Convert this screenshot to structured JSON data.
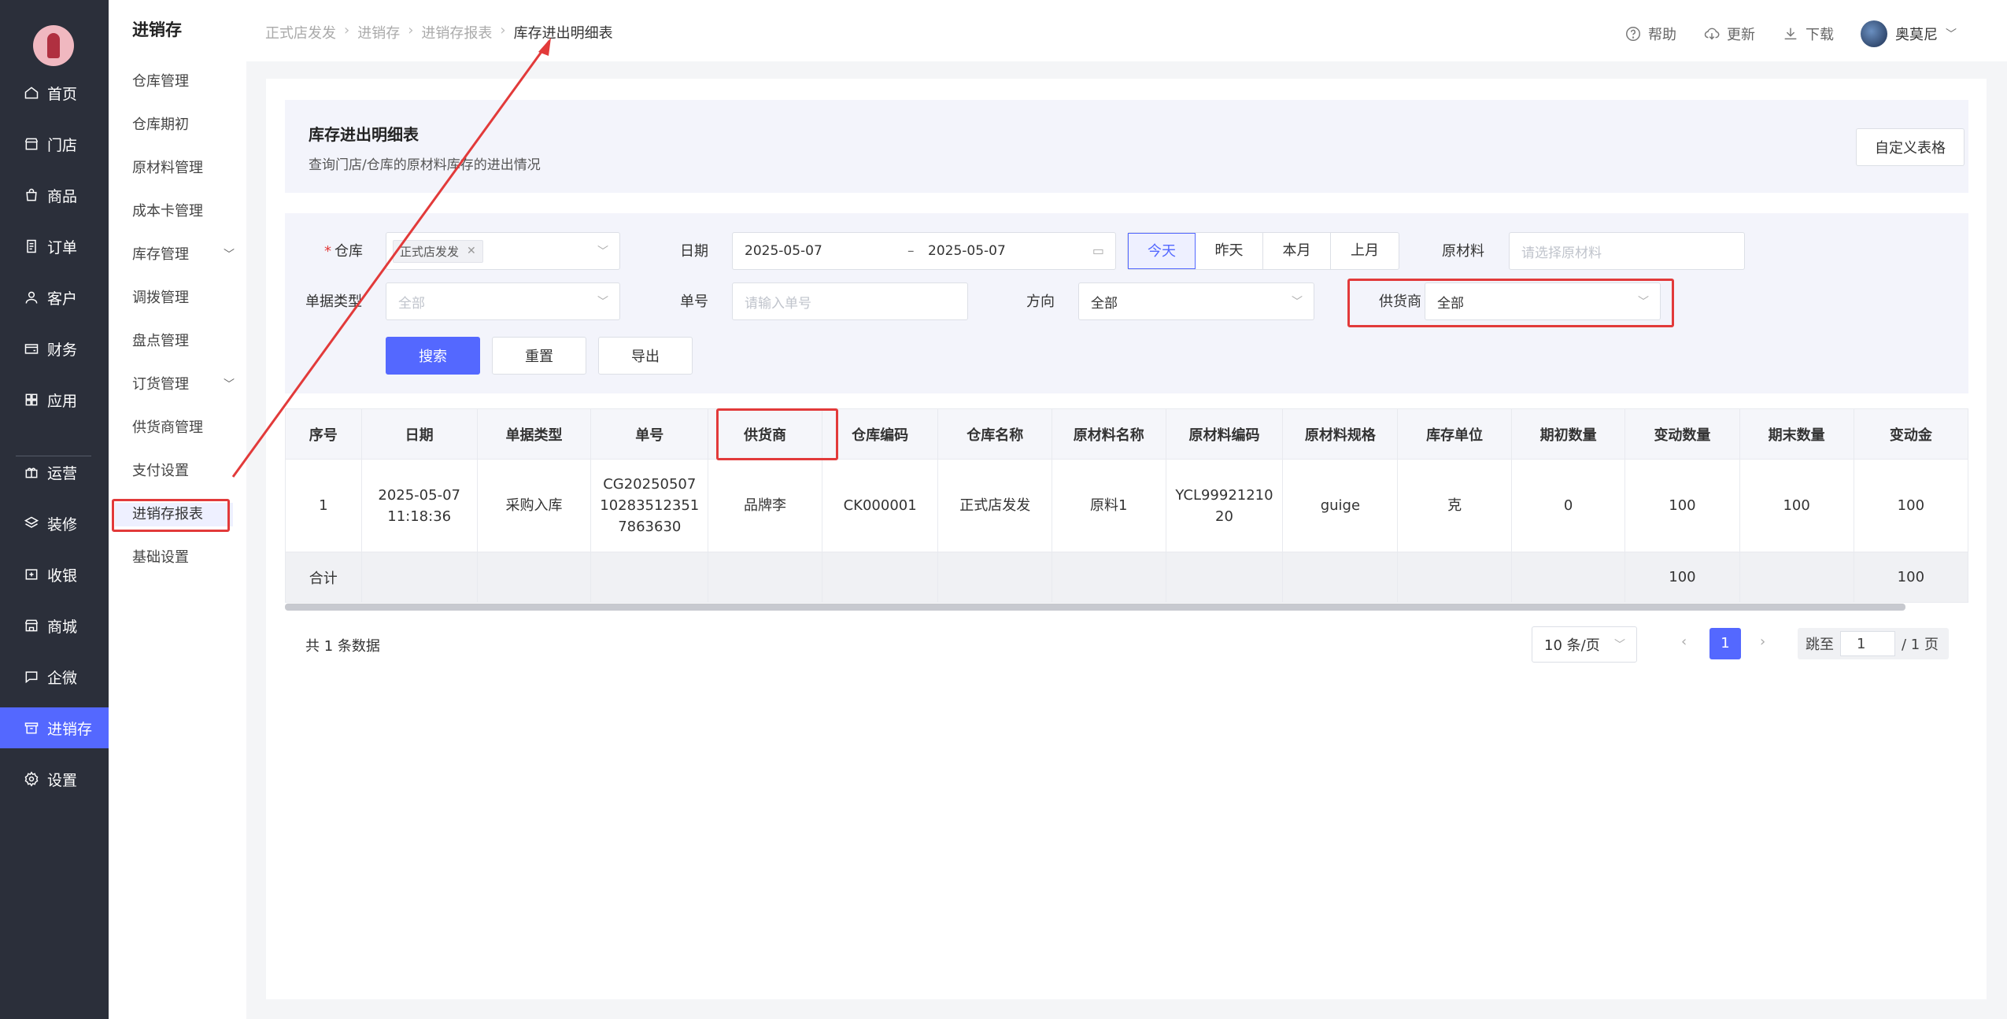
{
  "colors": {
    "accent": "#5468ff",
    "sidebar": "#2b2f3a",
    "highlight": "#e23a3a"
  },
  "nav": {
    "items": [
      {
        "label": "首页",
        "icon": "home-icon"
      },
      {
        "label": "门店",
        "icon": "store-icon"
      },
      {
        "label": "商品",
        "icon": "bag-icon"
      },
      {
        "label": "订单",
        "icon": "order-icon"
      },
      {
        "label": "客户",
        "icon": "user-icon"
      },
      {
        "label": "财务",
        "icon": "wallet-icon"
      },
      {
        "label": "应用",
        "icon": "apps-icon"
      },
      {
        "label": "运营",
        "icon": "gift-icon"
      },
      {
        "label": "装修",
        "icon": "layers-icon"
      },
      {
        "label": "收银",
        "icon": "cashier-icon"
      },
      {
        "label": "商城",
        "icon": "mall-icon"
      },
      {
        "label": "企微",
        "icon": "chat-icon"
      },
      {
        "label": "进销存",
        "icon": "inventory-icon"
      },
      {
        "label": "设置",
        "icon": "settings-icon"
      }
    ]
  },
  "subnav": {
    "title": "进销存",
    "items": [
      {
        "label": "仓库管理"
      },
      {
        "label": "仓库期初"
      },
      {
        "label": "原材料管理"
      },
      {
        "label": "成本卡管理"
      },
      {
        "label": "库存管理"
      },
      {
        "label": "调拨管理"
      },
      {
        "label": "盘点管理"
      },
      {
        "label": "订货管理"
      },
      {
        "label": "供货商管理"
      },
      {
        "label": "支付设置"
      },
      {
        "label": "进销存报表"
      },
      {
        "label": "基础设置"
      }
    ]
  },
  "breadcrumb": [
    "正式店发发",
    "进销存",
    "进销存报表",
    "库存进出明细表"
  ],
  "top_actions": {
    "help": "帮助",
    "update": "更新",
    "download": "下载",
    "user": "奥莫尼"
  },
  "header": {
    "title": "库存进出明细表",
    "description": "查询门店/仓库的原材料库存的进出情况",
    "customize_button": "自定义表格"
  },
  "filters": {
    "warehouse_label": "仓库",
    "warehouse_tag": "正式店发发",
    "date_label": "日期",
    "date_start": "2025-05-07",
    "date_sep": "–",
    "date_end": "2025-05-07",
    "quick_dates": [
      "今天",
      "昨天",
      "本月",
      "上月"
    ],
    "material_label": "原材料",
    "material_placeholder": "请选择原材料",
    "doc_type_label": "单据类型",
    "doc_type_placeholder": "全部",
    "doc_no_label": "单号",
    "doc_no_placeholder": "请输入单号",
    "direction_label": "方向",
    "direction_value": "全部",
    "supplier_label": "供货商",
    "supplier_value": "全部",
    "search_button": "搜索",
    "reset_button": "重置",
    "export_button": "导出"
  },
  "table": {
    "headers": [
      "序号",
      "日期",
      "单据类型",
      "单号",
      "供货商",
      "仓库编码",
      "仓库名称",
      "原材料名称",
      "原材料编码",
      "原材料规格",
      "库存单位",
      "期初数量",
      "变动数量",
      "期末数量",
      "变动金"
    ],
    "rows": [
      [
        "1",
        "2025-05-07\n11:18:36",
        "采购入库",
        "CG20250507\n10283512351\n7863630",
        "品牌李",
        "CK000001",
        "正式店发发",
        "原料1",
        "YCL99921210\n20",
        "guige",
        "克",
        "0",
        "100",
        "100",
        "100"
      ]
    ],
    "summary": [
      "合计",
      "",
      "",
      "",
      "",
      "",
      "",
      "",
      "",
      "",
      "",
      "",
      "100",
      "",
      "100"
    ]
  },
  "pagination": {
    "total": "共 1 条数据",
    "page_size": "10 条/页",
    "current": "1",
    "jump_label": "跳至",
    "jump_value": "1",
    "total_pages": "/ 1 页"
  }
}
